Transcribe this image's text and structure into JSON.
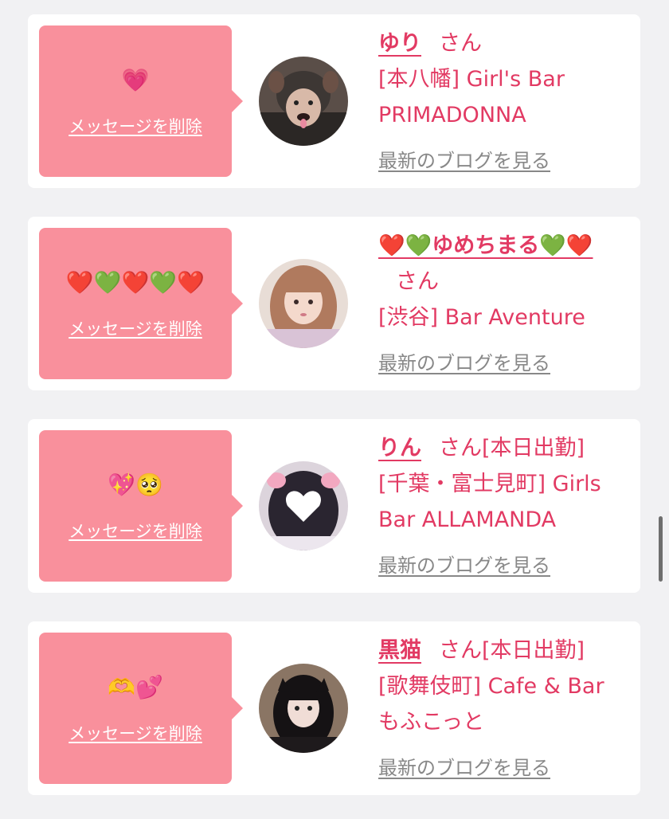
{
  "colors": {
    "background": "#f1f1f3",
    "card": "#ffffff",
    "bubble": "#f9909c",
    "name": "#e23a63",
    "blog_link": "#888888"
  },
  "entries": [
    {
      "message_icon": "💗",
      "delete_label": "メッセージを削除",
      "name": "ゆり",
      "honorific": "さん",
      "status": "",
      "shop": "[本八幡] Girl's Bar PRIMADONNA",
      "blog_label": "最新のブログを見る"
    },
    {
      "message_icon": "❤️💚❤️💚❤️",
      "delete_label": "メッセージを削除",
      "name": "❤️💚ゆめちまる💚❤️",
      "honorific": "さん",
      "status": "",
      "shop": "[渋谷] Bar Aventure",
      "blog_label": "最新のブログを見る"
    },
    {
      "message_icon": "💖🥺",
      "delete_label": "メッセージを削除",
      "name": "りん",
      "honorific": "さん",
      "status": "[本日出勤]",
      "shop": "[千葉・富士見町] Girls Bar ALLAMANDA",
      "blog_label": "最新のブログを見る"
    },
    {
      "message_icon": "🫶💕",
      "delete_label": "メッセージを削除",
      "name": "黒猫",
      "honorific": "さん",
      "status": "[本日出勤]",
      "shop": "[歌舞伎町] Cafe & Bar もふこっと",
      "blog_label": "最新のブログを見る"
    }
  ]
}
